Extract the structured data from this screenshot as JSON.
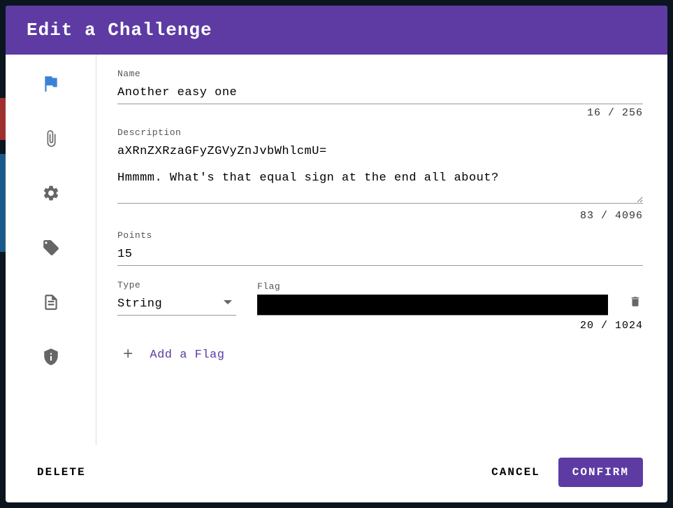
{
  "header": {
    "title": "Edit a Challenge"
  },
  "fields": {
    "name": {
      "label": "Name",
      "value": "Another easy one",
      "counter": "16 / 256"
    },
    "description": {
      "label": "Description",
      "value": "aXRnZXRzaGFyZGVyZnJvbWhlcmU=\n\nHmmmm. What's that equal sign at the end all about?",
      "counter": "83 / 4096"
    },
    "points": {
      "label": "Points",
      "value": "15"
    }
  },
  "flag": {
    "type_label": "Type",
    "type_value": "String",
    "flag_label": "Flag",
    "flag_value": "",
    "counter": "20 / 1024"
  },
  "add_flag": {
    "label": "Add a Flag"
  },
  "footer": {
    "delete": "DELETE",
    "cancel": "CANCEL",
    "confirm": "CONFIRM"
  }
}
